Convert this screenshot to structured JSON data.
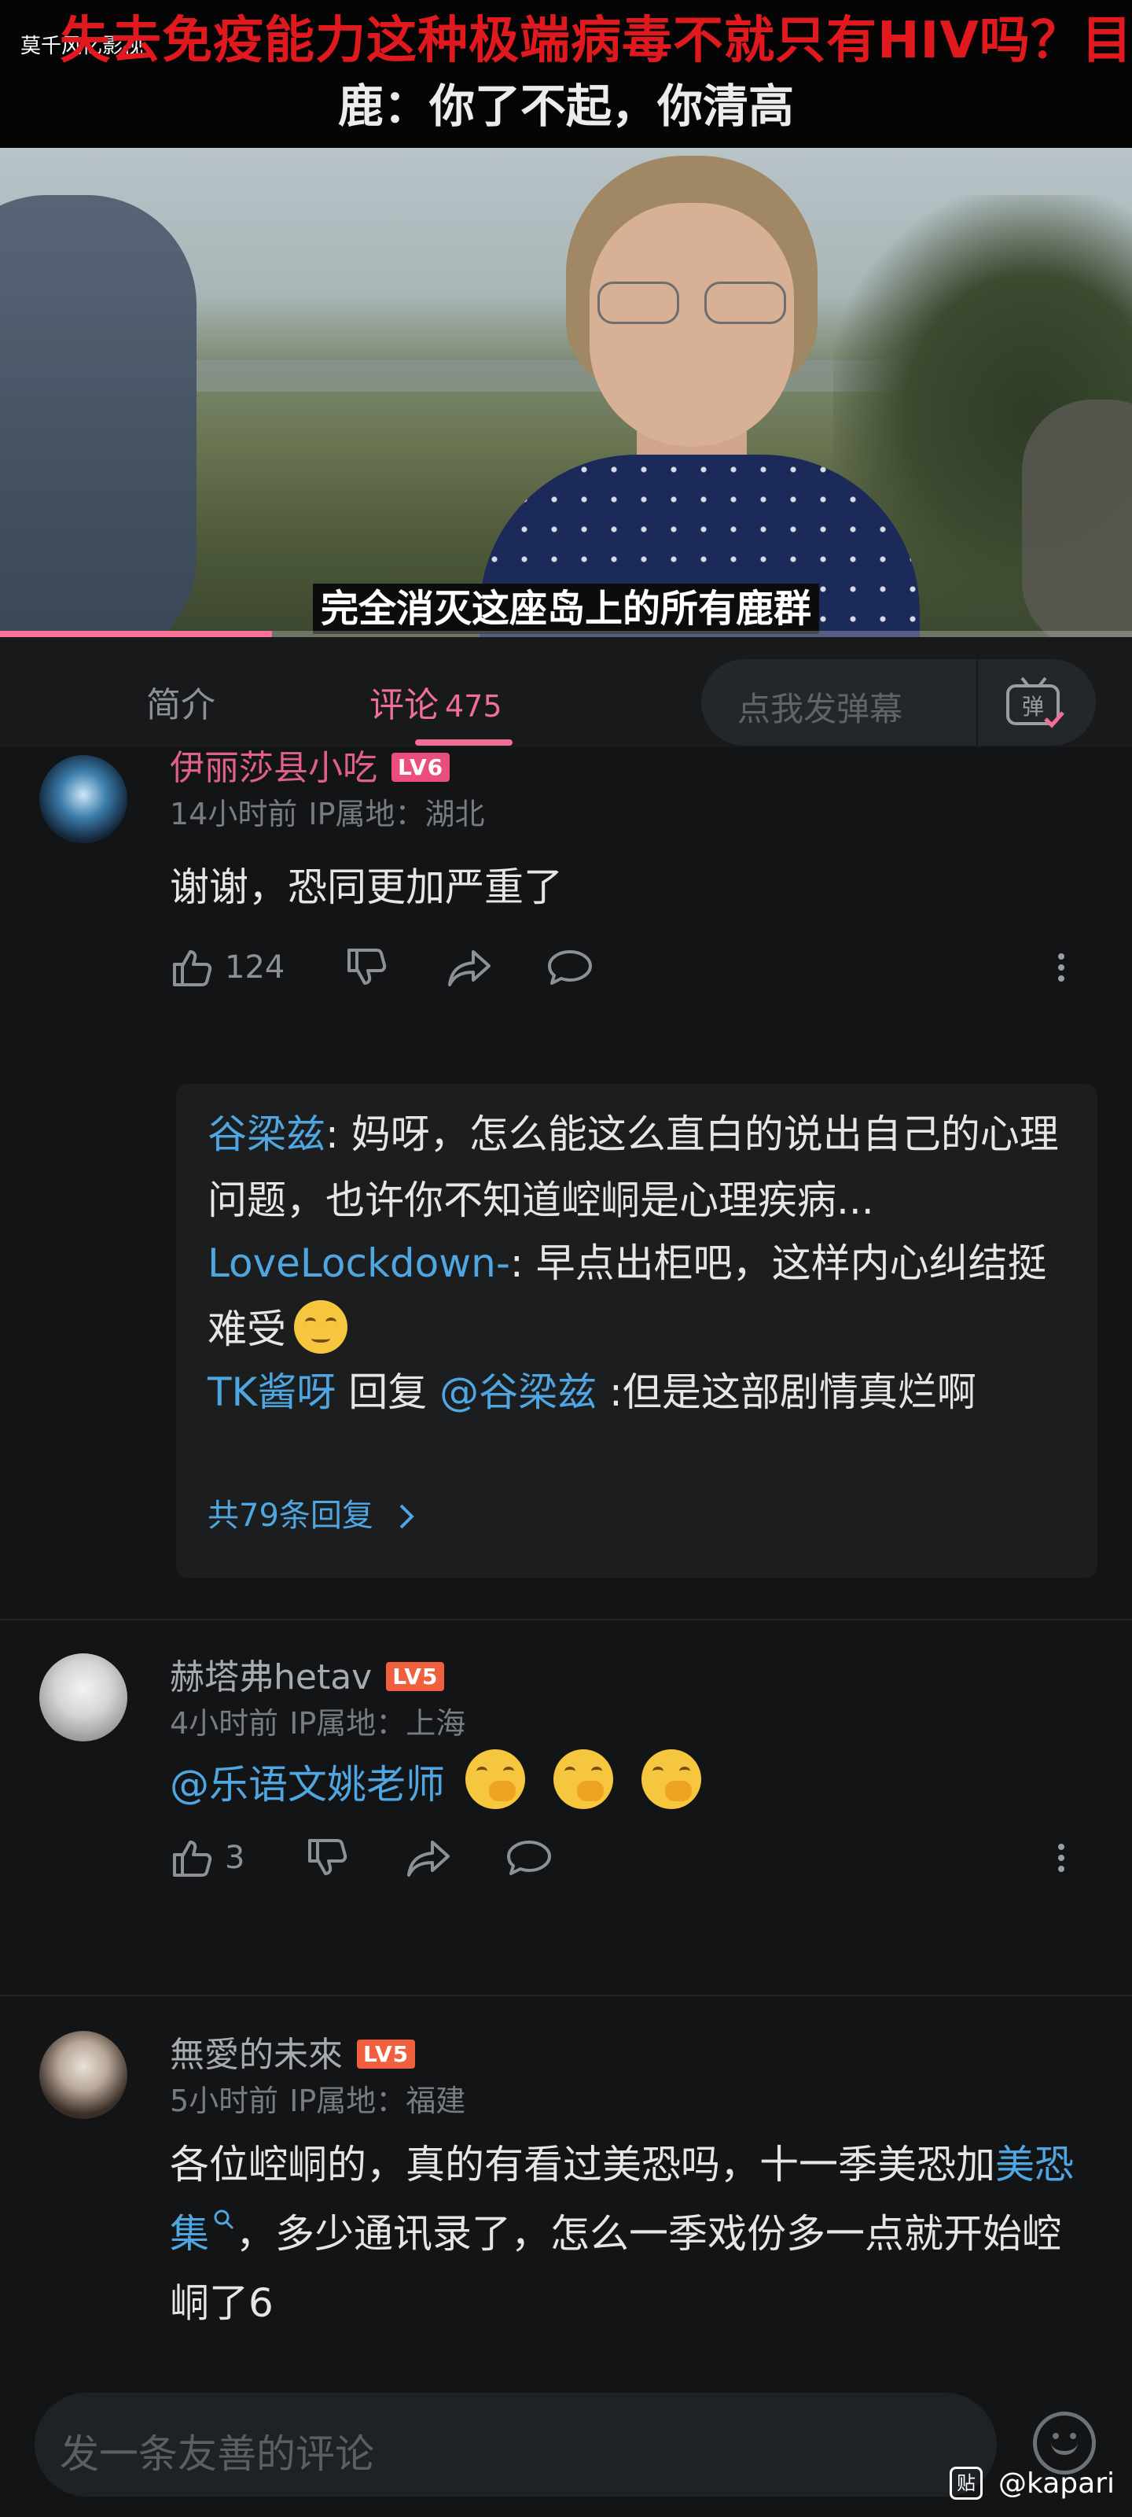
{
  "top": {
    "small_label": "莫千风忆影视",
    "danmaku_red": "失去免疫能力这种极端病毒不就只有HIV吗？目前",
    "danmaku_white": "鹿：你了不起，你清高"
  },
  "video": {
    "subtitle": "完全消灭这座岛上的所有鹿群",
    "progress": 0.24
  },
  "tabs": {
    "intro": "简介",
    "comments": "评论",
    "comment_count": "475",
    "danmaku_placeholder": "点我发弹幕",
    "danmaku_toggle_label": "弹"
  },
  "comments": [
    {
      "username": "伊丽莎县小吃",
      "level": "LV6",
      "time": "14小时前",
      "ip": "IP属地：湖北",
      "text": "谢谢，恐同更加严重了",
      "likes": "124",
      "replies": [
        {
          "user": "谷梁兹",
          "text": ": 妈呀，怎么能这么直白的说出自己的心理问题，也许你不知道崆峒是心理疾病..."
        },
        {
          "user": "LoveLockdown-",
          "text": ": 早点出柜吧，这样内心纠结挺难受"
        },
        {
          "user": "TK酱呀",
          "reply_word": " 回复 ",
          "mention": "@谷梁兹",
          "text": " :但是这部剧情真烂啊"
        }
      ],
      "more_replies": "共79条回复"
    },
    {
      "username": "赫塔弗hetav",
      "level": "LV5",
      "time": "4小时前",
      "ip": "IP属地：上海",
      "mention": "@乐语文姚老师",
      "likes": "3"
    },
    {
      "username": "無愛的未來",
      "level": "LV5",
      "time": "5小时前",
      "ip": "IP属地：福建",
      "text_part1": "各位崆峒的，真的有看过美恐吗，十一季美恐加",
      "link": "美恐集",
      "text_part2": "，多少通讯录了，怎么一季戏份多一点就开始崆峒了6"
    }
  ],
  "bottom": {
    "placeholder": "发一条友善的评论",
    "watermark_icon": "贴",
    "watermark": "@kapari"
  },
  "colors": {
    "accent_pink": "#f16f95",
    "link_blue": "#4fa6e0",
    "danmaku_red": "#e0191f",
    "level_orange": "#f0603f"
  }
}
